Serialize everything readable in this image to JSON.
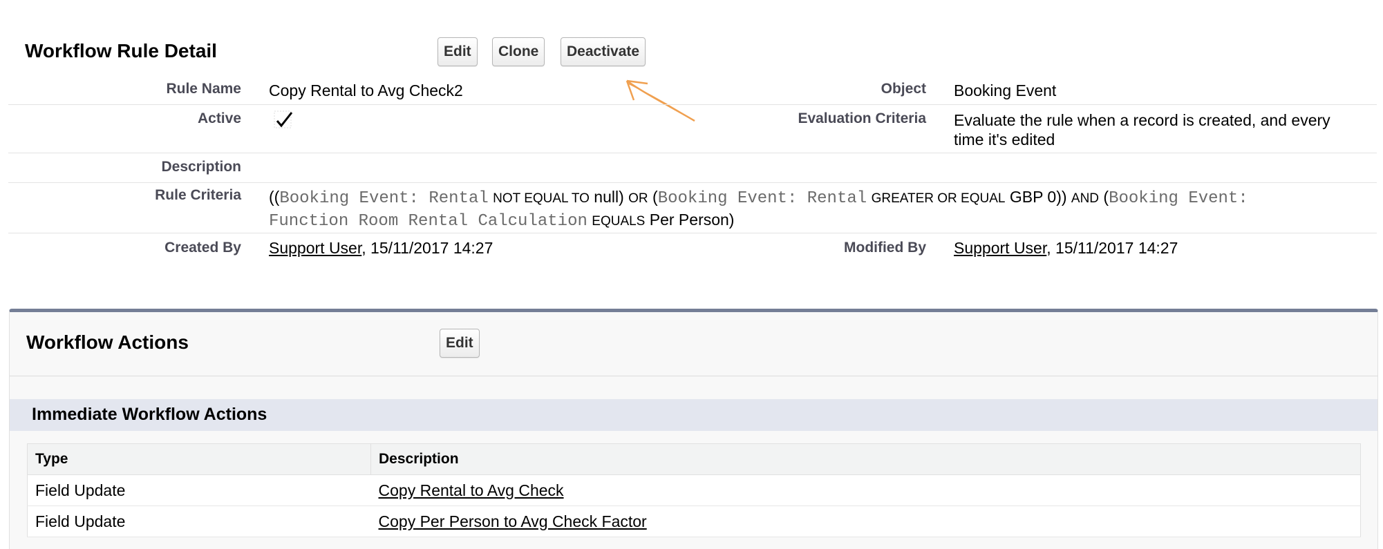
{
  "detail": {
    "title": "Workflow Rule Detail",
    "buttons": {
      "edit": "Edit",
      "clone": "Clone",
      "deactivate": "Deactivate"
    },
    "fields": {
      "rule_name_label": "Rule Name",
      "rule_name_value": "Copy Rental to Avg Check2",
      "object_label": "Object",
      "object_value": "Booking Event",
      "active_label": "Active",
      "active_value": true,
      "evaluation_label": "Evaluation Criteria",
      "evaluation_value": "Evaluate the rule when a record is created, and every time it's edited",
      "description_label": "Description",
      "description_value": "",
      "criteria_label": "Rule Criteria",
      "created_by_label": "Created By",
      "created_by_user": "Support User",
      "created_by_date": ", 15/11/2017 14:27",
      "modified_by_label": "Modified By",
      "modified_by_user": "Support User",
      "modified_by_date": ", 15/11/2017 14:27"
    },
    "criteria": {
      "p1": "((",
      "f1": "Booking Event: Rental",
      "op1": "NOT EQUAL TO",
      "v1": "null)",
      "j1": "OR",
      "p2": "(",
      "f2": "Booking Event: Rental",
      "op2": "GREATER OR EQUAL",
      "v2": "GBP 0))",
      "j2": "AND",
      "p3": "(",
      "f3a": "Booking Event:",
      "f3b": "Function Room Rental Calculation",
      "op3": "EQUALS",
      "v3": "Per Person)"
    }
  },
  "actions": {
    "title": "Workflow Actions",
    "edit_label": "Edit",
    "immediate_title": "Immediate Workflow Actions",
    "columns": [
      "Type",
      "Description"
    ],
    "rows": [
      {
        "type": "Field Update",
        "description": "Copy Rental to Avg Check"
      },
      {
        "type": "Field Update",
        "description": "Copy Per Person to Avg Check Factor"
      }
    ]
  },
  "colors": {
    "panel_border": "#747e96",
    "subheader_bg": "#e3e6ef",
    "annotation_arrow": "#f0a050"
  }
}
